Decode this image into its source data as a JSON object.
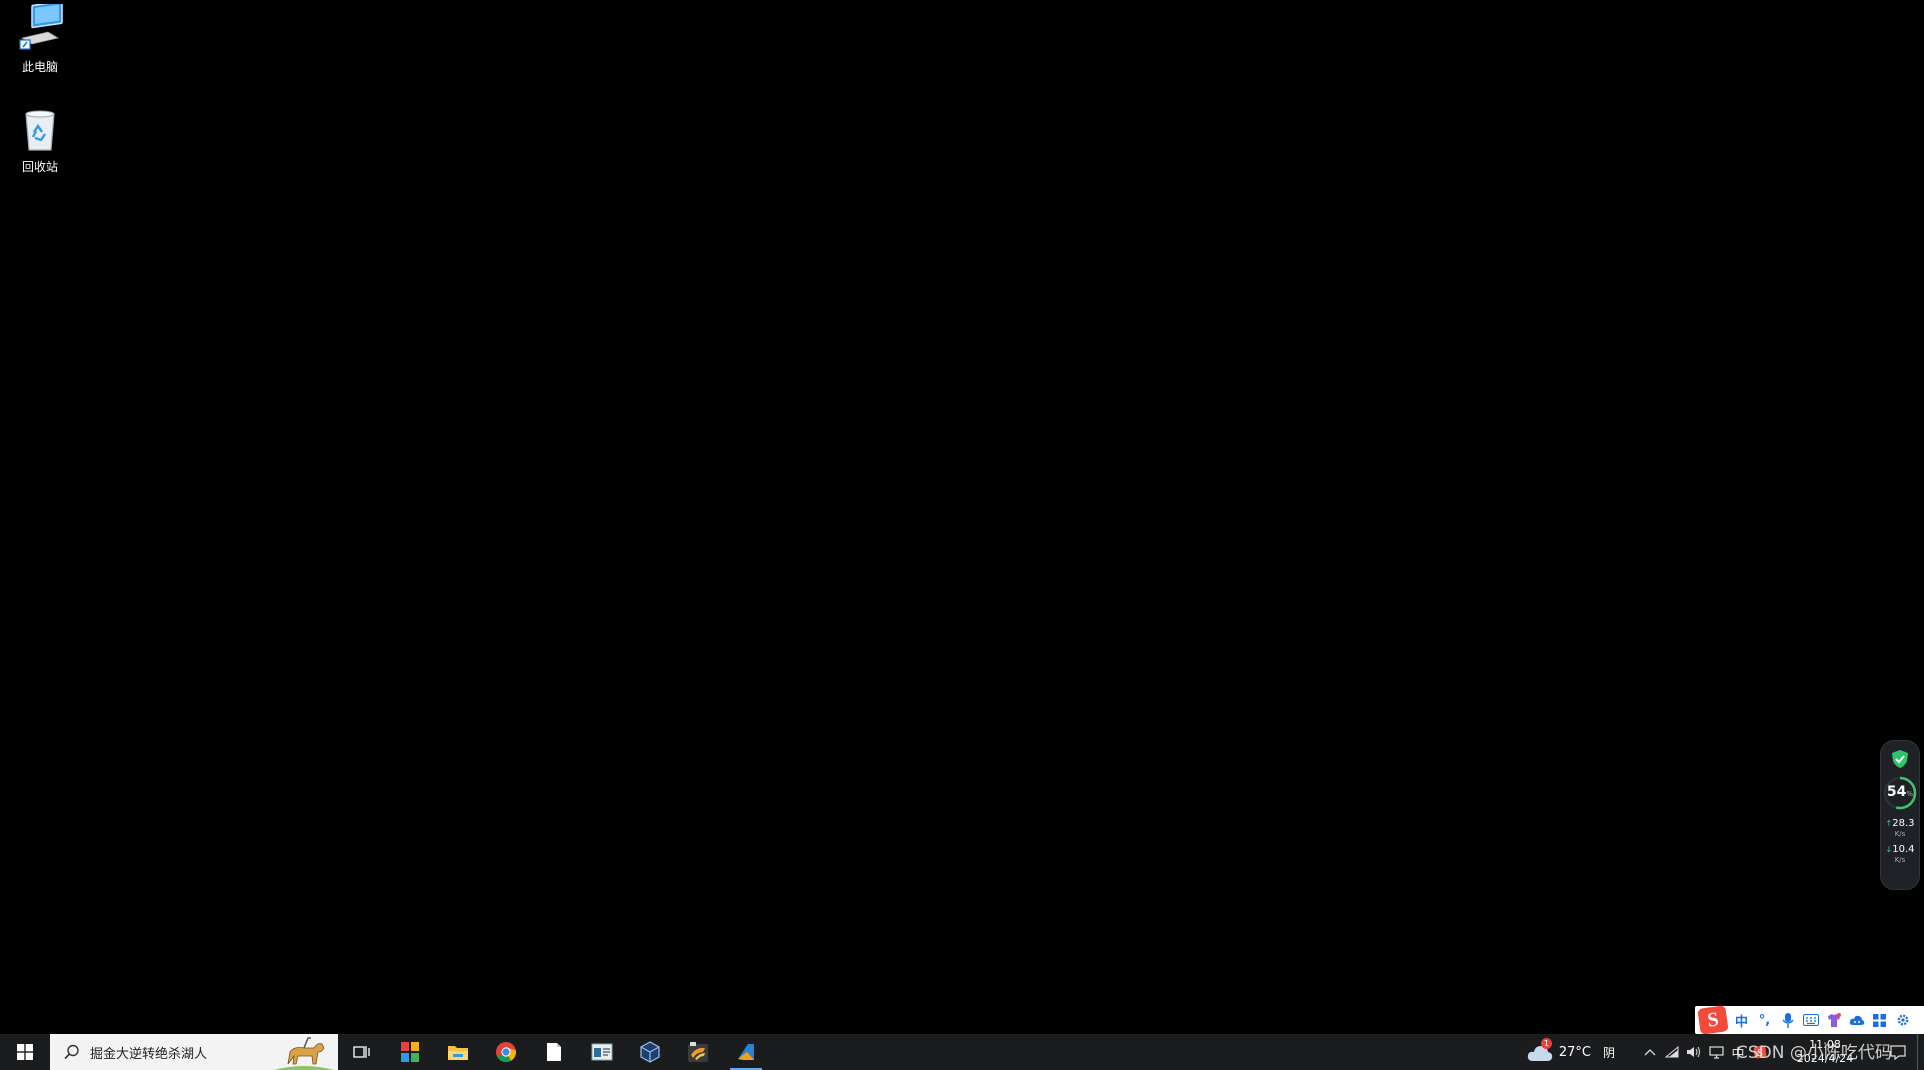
{
  "desktop": {
    "icons": [
      {
        "label": "此电脑",
        "icon": "computer-icon"
      },
      {
        "label": "回收站",
        "icon": "recycle-bin-icon"
      }
    ]
  },
  "monitor_widget": {
    "usage_value": "54",
    "usage_unit": "%",
    "upload_value": "28.3",
    "upload_unit": "K/s",
    "download_value": "10.4",
    "download_unit": "K/s",
    "accent": "#3fc46a"
  },
  "ime": {
    "logo_letter": "S",
    "mode_label": "中",
    "icons": [
      "punctuation-icon",
      "microphone-icon",
      "keyboard-icon",
      "skin-icon",
      "cloud-icon",
      "apps-icon",
      "settings-icon"
    ]
  },
  "taskbar": {
    "search_placeholder": "掘金大逆转绝杀湖人",
    "apps": [
      "task-view-icon",
      "app-grid-icon",
      "file-explorer-icon",
      "chrome-icon",
      "notepad-icon",
      "terminal-icon",
      "virtualbox-icon",
      "sublime-icon",
      "visual-studio-icon"
    ],
    "active_app": "visual-studio-icon",
    "accent": "#6aa8e8"
  },
  "tray": {
    "temperature": "27°C",
    "condition": "阴",
    "weather_badge": "1",
    "input_indicator": "中",
    "time": "11:08",
    "date": "2024/4/24",
    "watermark": "CSDN @小陈吃代码"
  }
}
